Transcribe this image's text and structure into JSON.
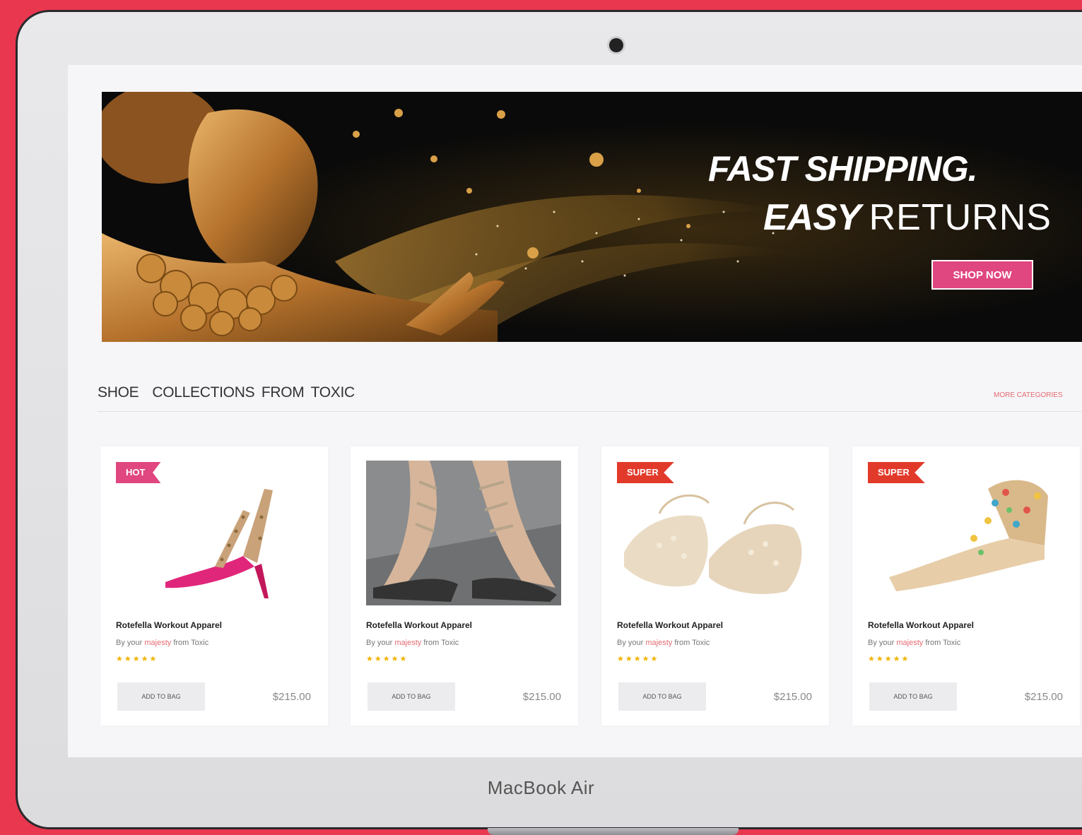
{
  "device": {
    "label": "MacBook Air"
  },
  "hero": {
    "line1": "FAST SHIPPING.",
    "line2_bold": "EASY",
    "line2_light": "RETURNS",
    "cta_label": "SHOP NOW"
  },
  "section": {
    "title": "SHOE  COLLECTIONS FROM TOXIC",
    "more_link": "MORE CATEGORIES"
  },
  "products": [
    {
      "badge": "HOT",
      "title": "Rotefella Workout Apparel",
      "desc_prefix": "By your",
      "desc_accent": "majesty",
      "desc_suffix": "from Toxic",
      "rating": "★★★★★",
      "add_label": "ADD TO BAG",
      "price": "$215.00"
    },
    {
      "badge": "",
      "title": "Rotefella Workout Apparel",
      "desc_prefix": "By your",
      "desc_accent": "majesty",
      "desc_suffix": "from Toxic",
      "rating": "★★★★★",
      "add_label": "ADD TO BAG",
      "price": "$215.00"
    },
    {
      "badge": "SUPER",
      "title": "Rotefella Workout Apparel",
      "desc_prefix": "By your",
      "desc_accent": "majesty",
      "desc_suffix": "from Toxic",
      "rating": "★★★★★",
      "add_label": "ADD TO BAG",
      "price": "$215.00"
    },
    {
      "badge": "SUPER",
      "title": "Rotefella Workout Apparel",
      "desc_prefix": "By your",
      "desc_accent": "majesty",
      "desc_suffix": "from Toxic",
      "rating": "★★★★★",
      "add_label": "ADD TO BAG",
      "price": "$215.00"
    }
  ],
  "colors": {
    "background": "#e8374f",
    "accent_pink": "#e0467f",
    "badge_red": "#e23a2a",
    "star": "#f0b400"
  },
  "icons": [
    "camera-dot",
    "star-icon"
  ]
}
